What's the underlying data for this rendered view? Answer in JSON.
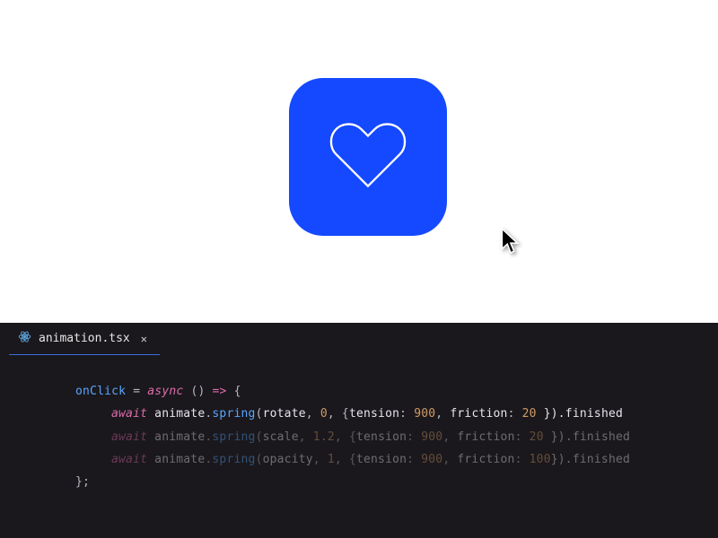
{
  "editor": {
    "tab": {
      "filename": "animation.tsx",
      "close_label": "✕"
    },
    "code": {
      "l1": {
        "fn": "onClick",
        "assign": " = ",
        "kw_async": "async",
        "paren": " () ",
        "arrow": "=>",
        "brace": " {"
      },
      "l2": {
        "kw_await": "await",
        "obj": " animate",
        "dot": ".",
        "method": "spring",
        "open": "(",
        "arg1": "rotate",
        "c1": ", ",
        "n1": "0",
        "c2": ", {",
        "p1": "tension",
        "col1": ": ",
        "v1": "900",
        "c3": ", ",
        "p2": "friction",
        "col2": ": ",
        "v2": "20",
        "end": " }).finished"
      },
      "l3": {
        "kw_await": "await",
        "obj": " animate",
        "dot": ".",
        "method": "spring",
        "open": "(",
        "arg1": "scale",
        "c1": ", ",
        "n1": "1.2",
        "c2": ", {",
        "p1": "tension",
        "col1": ": ",
        "v1": "900",
        "c3": ", ",
        "p2": "friction",
        "col2": ": ",
        "v2": "20",
        "end": " }).finished"
      },
      "l4": {
        "kw_await": "await",
        "obj": " animate",
        "dot": ".",
        "method": "spring",
        "open": "(",
        "arg1": "opacity",
        "c1": ", ",
        "n1": "1",
        "c2": ", {",
        "p1": "tension",
        "col1": ": ",
        "v1": "900",
        "c3": ", ",
        "p2": "friction",
        "col2": ": ",
        "v2": "100",
        "end": "}).finished"
      },
      "l5": {
        "close": "};"
      }
    }
  },
  "colors": {
    "button_bg": "#1549ff",
    "editor_bg": "#1a181c",
    "tab_active_border": "#3b6fd9"
  }
}
